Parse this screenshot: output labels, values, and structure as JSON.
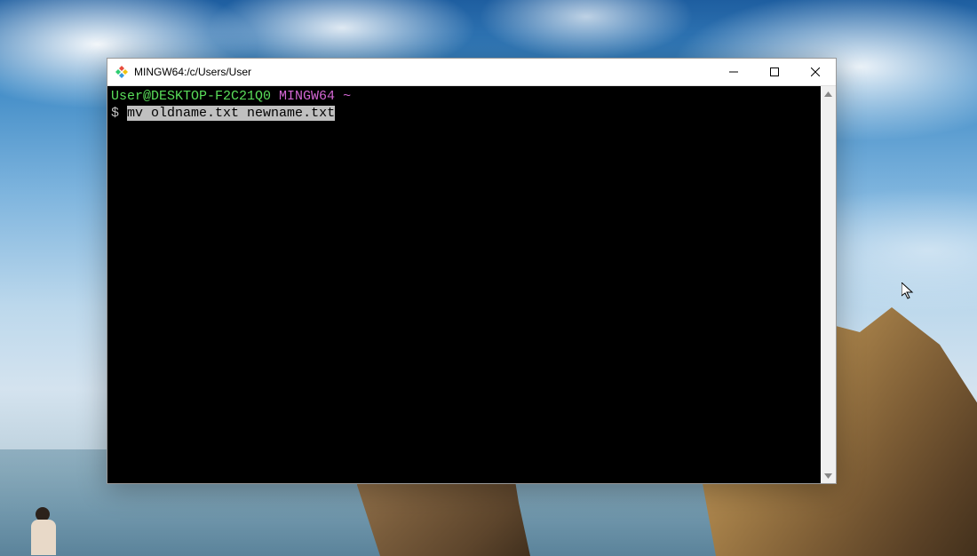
{
  "window": {
    "title": "MINGW64:/c/Users/User"
  },
  "terminal": {
    "prompt_user": "User@DESKTOP-F2C21Q0",
    "prompt_env": "MINGW64",
    "prompt_path": "~",
    "prompt_symbol": "$",
    "command": "mv oldname.txt newname.txt"
  },
  "colors": {
    "prompt_user": "#5ade5a",
    "prompt_env": "#d467d4",
    "terminal_bg": "#000000",
    "highlight_bg": "#c0c0c0",
    "highlight_fg": "#000000"
  }
}
